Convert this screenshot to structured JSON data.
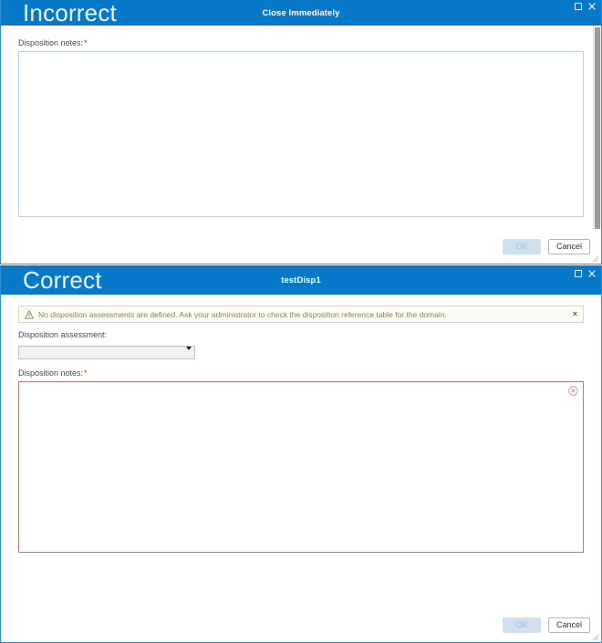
{
  "panels": [
    {
      "overlay_label": "Incorrect",
      "title": "Close Immediately",
      "window_controls": {
        "maximize": "maximize-icon",
        "close": "close-icon"
      },
      "notes_label": "Disposition notes:",
      "notes_required_marker": "*",
      "notes_value": "",
      "notes_placeholder": "",
      "buttons": {
        "ok": "OK",
        "cancel": "Cancel"
      }
    },
    {
      "overlay_label": "Correct",
      "title": "testDisp1",
      "window_controls": {
        "maximize": "maximize-icon",
        "close": "close-icon"
      },
      "warning": {
        "icon": "warning-triangle-icon",
        "text": "No disposition assessments are defined. Ask your administrator to check the disposition reference table for the domain.",
        "dismiss": "×"
      },
      "assessment_label": "Disposition assessment:",
      "assessment_value": "",
      "assessment_options": [
        ""
      ],
      "notes_label": "Disposition notes:",
      "notes_required_marker": "*",
      "notes_value": "",
      "notes_placeholder": "",
      "error_icon": "error-circle-icon",
      "buttons": {
        "ok": "OK",
        "cancel": "Cancel"
      }
    }
  ],
  "colors": {
    "titlebar_blue": "#0878c8",
    "overlay_text": "#eaf4fb",
    "required_red": "#c0392b",
    "error_border": "#c0776d",
    "warning_bg": "#fbfbf3",
    "warning_border": "#ddd9c0",
    "warning_text": "#8a8463",
    "ok_disabled_bg": "#cfe0ef"
  }
}
